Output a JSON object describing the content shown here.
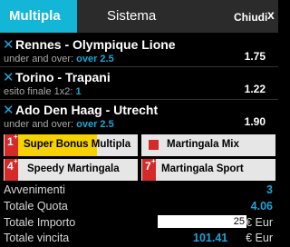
{
  "tabs": {
    "active": "Multipla",
    "other": "Sistema",
    "close_label": "Chiudi",
    "close_icon": "x"
  },
  "bets": [
    {
      "match": "Rennes - Olympique Lione",
      "market": "under and over:",
      "selection": "over 2.5",
      "odd": "1.75"
    },
    {
      "match": "Torino - Trapani",
      "market": "esito finale 1x2:",
      "selection": "1",
      "odd": "1.22"
    },
    {
      "match": "Ado Den Haag - Utrecht",
      "market": "under and over:",
      "selection": "over 2.5",
      "odd": "1.90"
    }
  ],
  "bonus": {
    "super_bonus": {
      "num": "1",
      "label": "Super Bonus Multipla"
    },
    "martingala_mix": {
      "label": "Martingala Mix"
    },
    "speedy": {
      "num": "4",
      "label": "Speedy Martingala"
    },
    "sport": {
      "num": "7",
      "label": "Martingala Sport"
    },
    "plus": "+"
  },
  "summary": {
    "avvenimenti_label": "Avvenimenti",
    "avvenimenti": "3",
    "quota_label": "Totale Quota",
    "quota": "4.06",
    "importo_label": "Totale Importo",
    "importo": "25",
    "currency": "€ Eur",
    "vincita_label": "Totale vincita",
    "vincita": "101.41"
  },
  "colors": {
    "accent": "#14b6d8",
    "badge": "#d42a2a",
    "highlight": "#f5d200"
  }
}
